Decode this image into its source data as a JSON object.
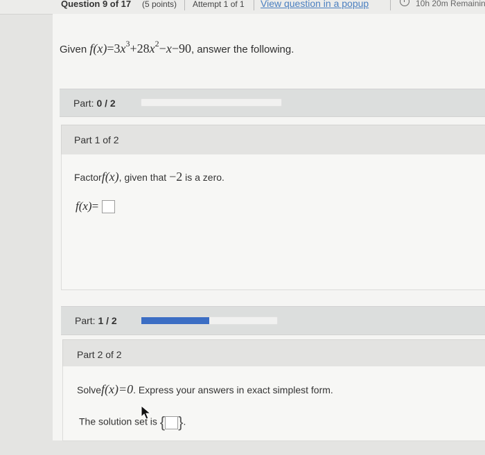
{
  "header": {
    "question": "Question 9 of 17",
    "points": "(5 points)",
    "attempt": "Attempt 1 of 1",
    "popup_link": "View question in a popup",
    "timer": "10h 20m Remaining"
  },
  "problem": {
    "given_prefix": "Given",
    "function": "f(x)",
    "equals": "=",
    "expr_a": "3x",
    "exp_a": "3",
    "expr_b": "+28x",
    "exp_b": "2",
    "expr_c": "−x−90",
    "given_suffix": ", answer the following."
  },
  "part_progress_1": {
    "label": "Part:",
    "value": "0 / 2",
    "fraction": 0
  },
  "part_progress_2": {
    "label": "Part:",
    "value": "1 / 2",
    "fraction": 0.5
  },
  "part1": {
    "header": "Part 1 of 2",
    "instruction_prefix": "Factor",
    "instruction_func": "f(x)",
    "instruction_mid": ", given that",
    "instruction_value": "−2",
    "instruction_suffix": "is a zero.",
    "answer_func": "f(x)",
    "answer_equals": "="
  },
  "part2": {
    "header": "Part 2 of 2",
    "instruction_prefix": "Solve",
    "instruction_eq": "f(x)=0",
    "instruction_suffix": ". Express your answers in exact simplest form.",
    "solution_label": "The solution set is",
    "brace_open": "{",
    "brace_close": "}",
    "period": "."
  }
}
